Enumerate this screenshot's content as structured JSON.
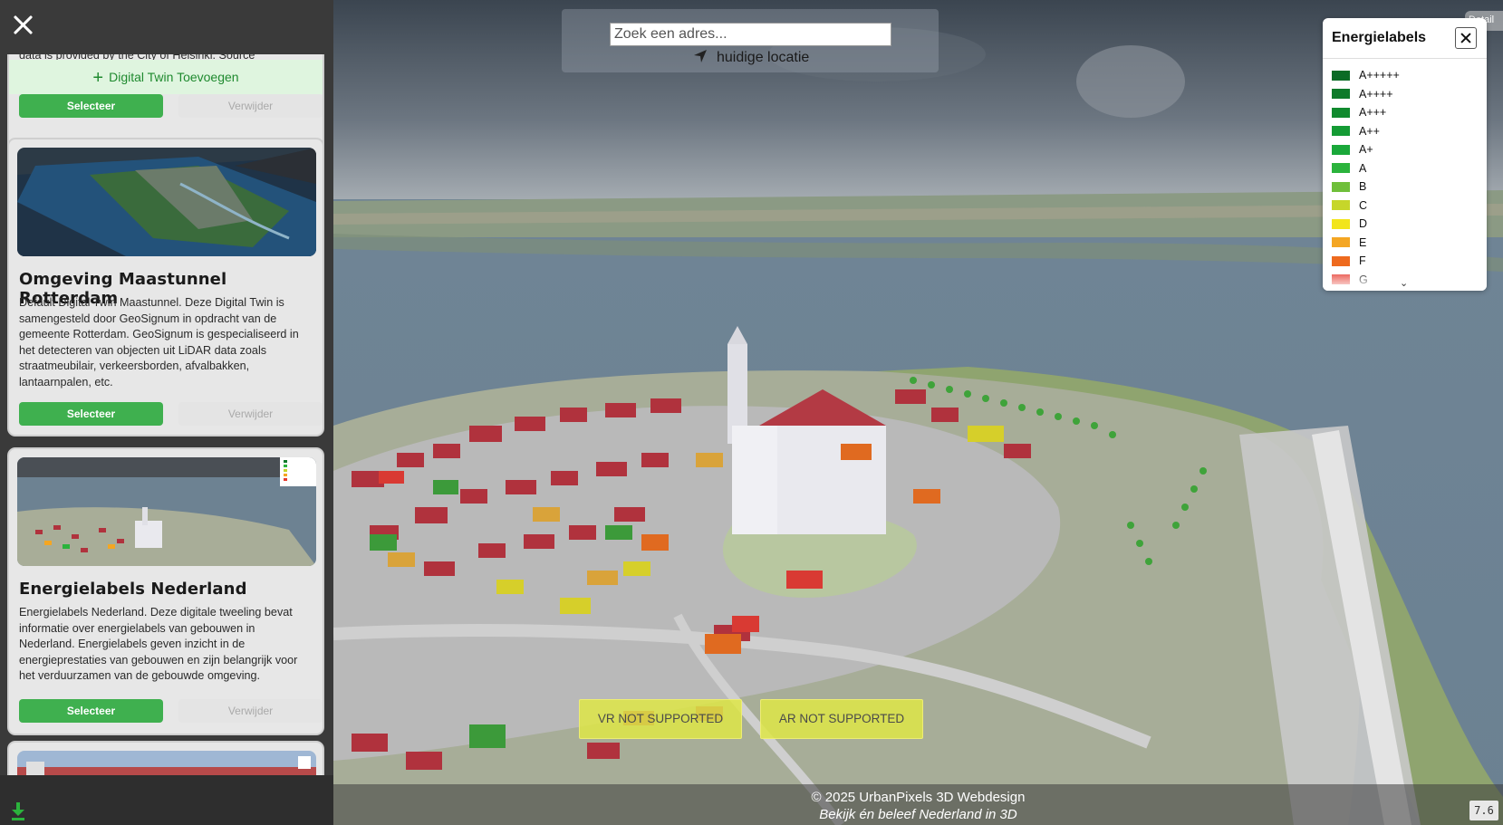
{
  "sidebar": {
    "partial_text": "data is provided by the City of Helsinki. Source",
    "add_twin_label": "Digital Twin Toevoegen",
    "cards": [
      {
        "select_label": "Selecteer",
        "remove_label": "Verwijder"
      },
      {
        "title": "Omgeving Maastunnel Rotterdam",
        "description": "Default Digital Twin Maastunnel. Deze Digital Twin is samengesteld door GeoSignum in opdracht van de gemeente Rotterdam. GeoSignum is gespecialiseerd in het detecteren van objecten uit LiDAR data zoals straatmeubilair, verkeersborden, afvalbakken, lantaarnpalen, etc.",
        "select_label": "Selecteer",
        "remove_label": "Verwijder"
      },
      {
        "title": "Energielabels Nederland",
        "description": "Energielabels Nederland. Deze digitale tweeling bevat informatie over energielabels van gebouwen in Nederland. Energielabels geven inzicht in de energieprestaties van gebouwen en zijn belangrijk voor het verduurzamen van de gebouwde omgeving.",
        "select_label": "Selecteer",
        "remove_label": "Verwijder"
      }
    ],
    "icons": {
      "close": "close-icon",
      "download": "download-icon",
      "plus": "plus-icon"
    }
  },
  "search": {
    "placeholder": "Zoek een adres...",
    "current_location_label": "huidige locatie",
    "location_icon": "navigation-arrow-icon"
  },
  "legend": {
    "title": "Energielabels",
    "items": [
      {
        "label": "A+++++",
        "color": "#0b6b26"
      },
      {
        "label": "A++++",
        "color": "#0e7a2a"
      },
      {
        "label": "A+++",
        "color": "#108a2e"
      },
      {
        "label": "A++",
        "color": "#149b34"
      },
      {
        "label": "A+",
        "color": "#1aa83a"
      },
      {
        "label": "A",
        "color": "#2bb33c"
      },
      {
        "label": "B",
        "color": "#6fbf3a"
      },
      {
        "label": "C",
        "color": "#c6d62a"
      },
      {
        "label": "D",
        "color": "#f2e51b"
      },
      {
        "label": "E",
        "color": "#f4a623"
      },
      {
        "label": "F",
        "color": "#ee6a1e"
      },
      {
        "label": "G",
        "color": "#e63a2e"
      }
    ],
    "more_indicator": "⌄"
  },
  "detail_stub": "Detail",
  "xr": {
    "vr_label": "VR NOT SUPPORTED",
    "ar_label": "AR NOT SUPPORTED"
  },
  "footer": {
    "credit": "© 2025 UrbanPixels 3D Webdesign",
    "tagline": "Bekijk én beleef Nederland in 3D",
    "version": "7.6"
  },
  "colors": {
    "accent_green": "#3fb04f",
    "xr_yellow": "#dee646"
  }
}
